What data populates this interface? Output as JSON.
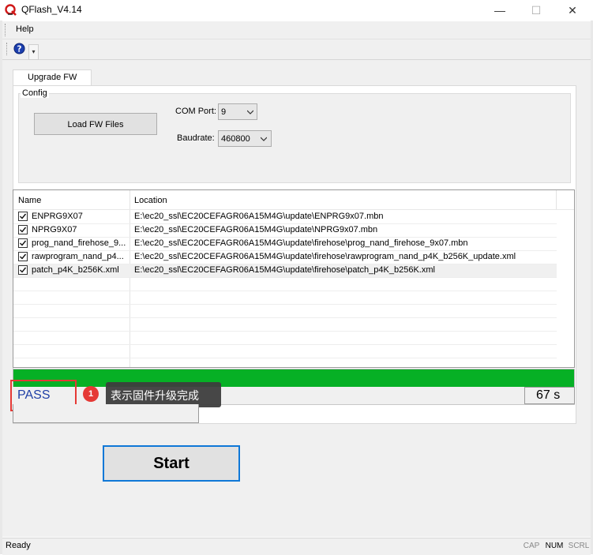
{
  "window": {
    "title": "QFlash_V4.14",
    "minimize_glyph": "—",
    "maximize_glyph": "☐",
    "close_glyph": "✕"
  },
  "menu": {
    "help": "Help"
  },
  "toolbar": {
    "help_icon": "help-question-icon",
    "overflow_glyph": "▾"
  },
  "tabs": [
    {
      "label": "Upgrade FW",
      "selected": true
    }
  ],
  "config": {
    "group_label": "Config",
    "load_button": "Load FW Files",
    "com_port_label": "COM Port:",
    "com_port_value": "9",
    "baudrate_label": "Baudrate:",
    "baudrate_value": "460800"
  },
  "file_table": {
    "columns": [
      "Name",
      "Location"
    ],
    "rows": [
      {
        "checked": true,
        "name": "ENPRG9X07",
        "location": "E:\\ec20_ssl\\EC20CEFAGR06A15M4G\\update\\ENPRG9x07.mbn"
      },
      {
        "checked": true,
        "name": "NPRG9X07",
        "location": "E:\\ec20_ssl\\EC20CEFAGR06A15M4G\\update\\NPRG9x07.mbn"
      },
      {
        "checked": true,
        "name": "prog_nand_firehose_9...",
        "location": "E:\\ec20_ssl\\EC20CEFAGR06A15M4G\\update\\firehose\\prog_nand_firehose_9x07.mbn"
      },
      {
        "checked": true,
        "name": "rawprogram_nand_p4...",
        "location": "E:\\ec20_ssl\\EC20CEFAGR06A15M4G\\update\\firehose\\rawprogram_nand_p4K_b256K_update.xml"
      },
      {
        "checked": true,
        "name": "patch_p4K_b256K.xml",
        "location": "E:\\ec20_ssl\\EC20CEFAGR06A15M4G\\update\\firehose\\patch_p4K_b256K.xml"
      }
    ]
  },
  "progress": {
    "fraction": 1.0,
    "color": "#06b025"
  },
  "status": {
    "text": "PASS",
    "elapsed": "67 s"
  },
  "annotation": {
    "number": "1",
    "text": "表示固件升级完成",
    "color": "#e53935"
  },
  "start_button": "Start",
  "statusbar": {
    "text": "Ready",
    "cap": "CAP",
    "num": "NUM",
    "scrl": "SCRL"
  },
  "colors": {
    "accent_border": "#0f78d7",
    "status_text": "#1f3fa6"
  }
}
